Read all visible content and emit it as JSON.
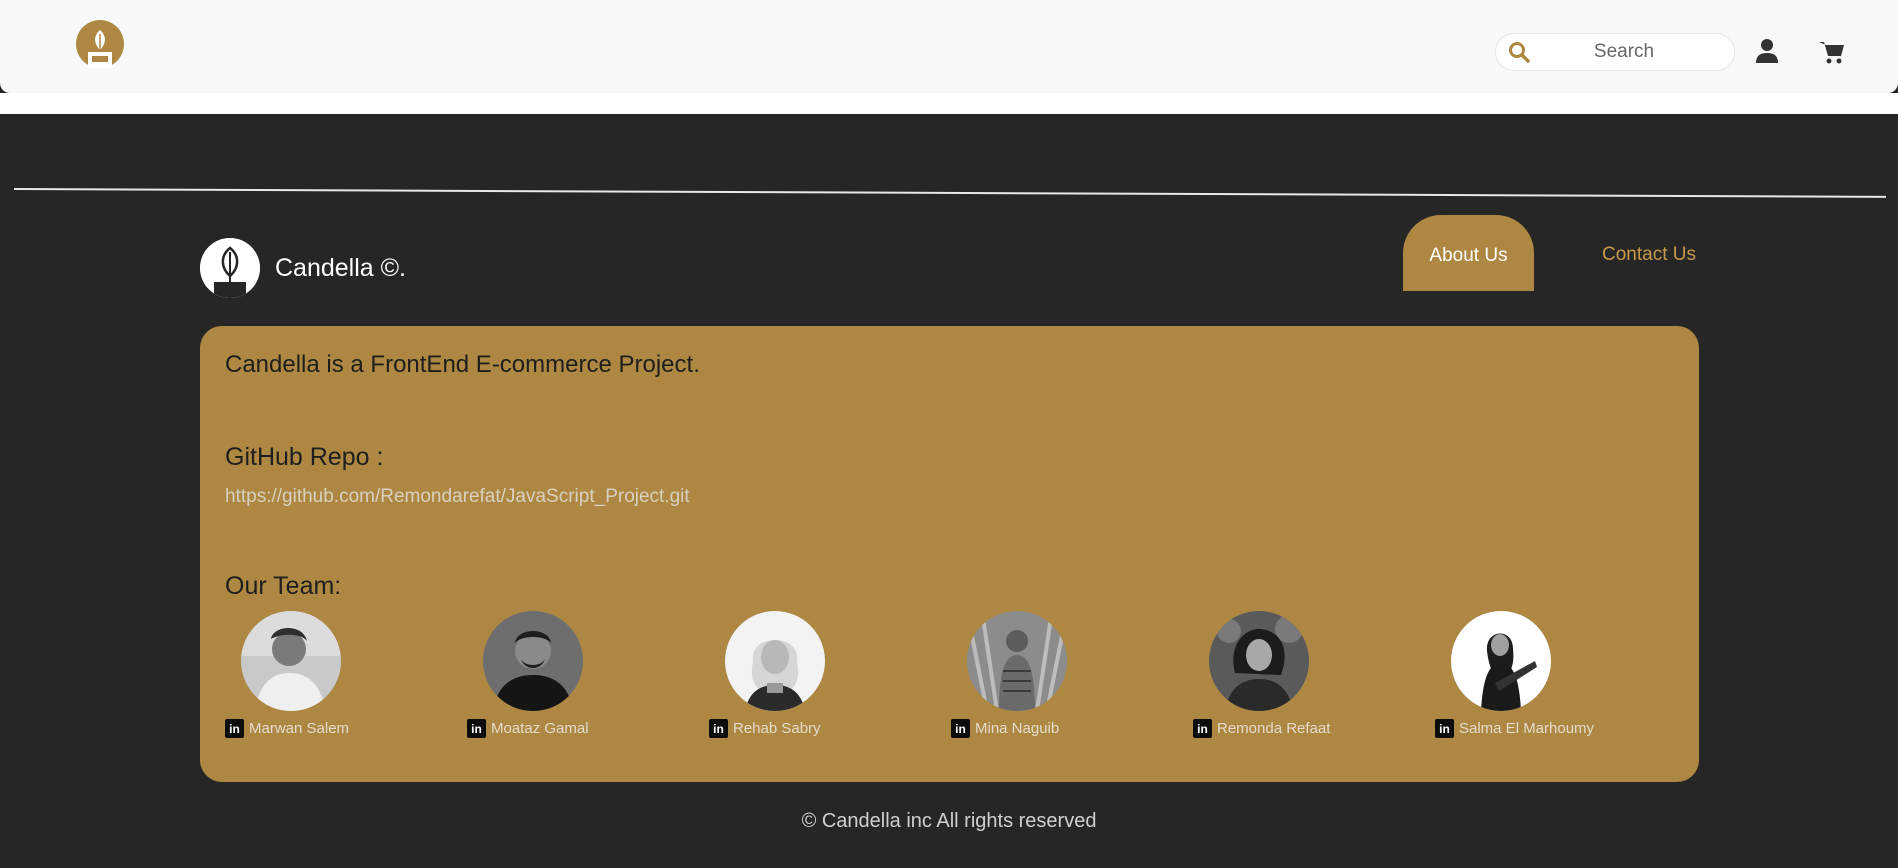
{
  "header": {
    "search_placeholder": "Search",
    "icons": {
      "logo": "candle-leaf-logo",
      "search": "search-icon",
      "user": "user-icon",
      "cart": "cart-icon"
    }
  },
  "brand": {
    "name": "Candella ©."
  },
  "tabs": {
    "about": "About Us",
    "contact": "Contact Us"
  },
  "about": {
    "intro": "Candella is a FrontEnd E-commerce Project.",
    "repo_title": "GitHub Repo :",
    "repo_link": "https://github.com/Remondarefat/JavaScript_Project.git",
    "team_title": "Our Team:",
    "members": [
      {
        "name": "Marwan Salem"
      },
      {
        "name": "Moataz Gamal"
      },
      {
        "name": "Rehab Sabry"
      },
      {
        "name": "Mina Naguib"
      },
      {
        "name": "Remonda Refaat"
      },
      {
        "name": "Salma El Marhoumy"
      }
    ],
    "linkedin_glyph": "in"
  },
  "footer": {
    "copyright": "© Candella inc All rights reserved"
  },
  "colors": {
    "accent": "#ae8842",
    "dark_bg": "#262626",
    "topbar_bg": "#f7f8fa",
    "link_gold": "#c79a4a"
  }
}
